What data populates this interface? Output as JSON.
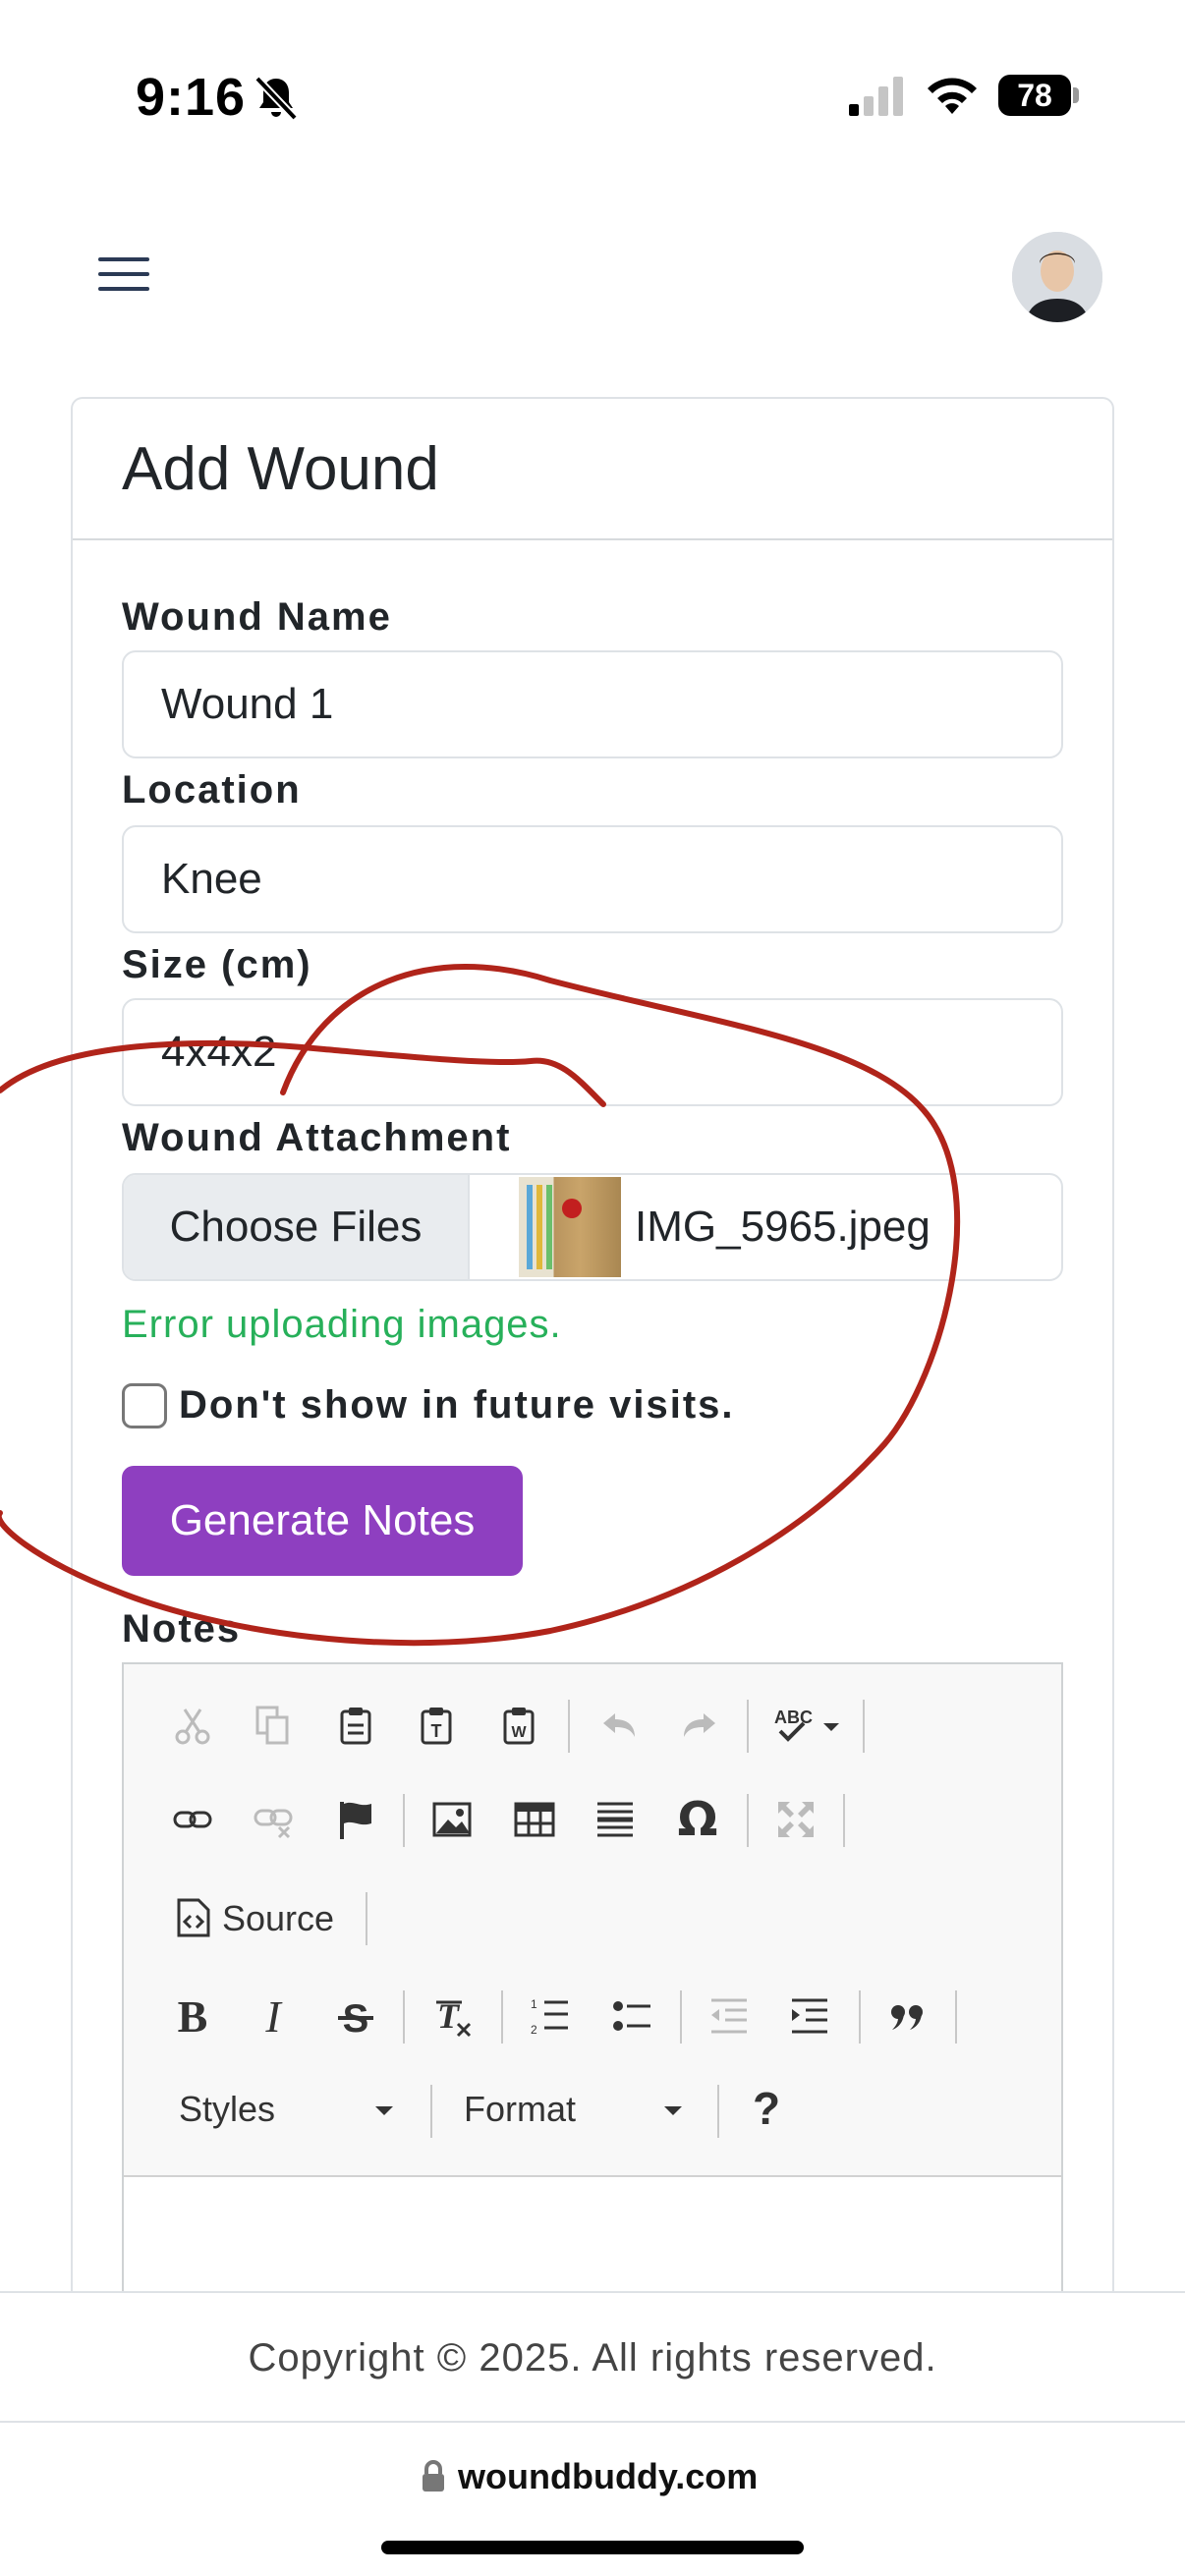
{
  "status_bar": {
    "time": "9:16",
    "battery": "78"
  },
  "page": {
    "title": "Add Wound"
  },
  "form": {
    "wound_name_label": "Wound Name",
    "wound_name_value": "Wound 1",
    "location_label": "Location",
    "location_value": "Knee",
    "size_label": "Size (cm)",
    "size_value": "4x4x2",
    "attachment_label": "Wound Attachment",
    "choose_files_label": "Choose Files",
    "file_name": "IMG_5965.jpeg",
    "error_message": "Error uploading images.",
    "checkbox_label": "Don't show in future visits.",
    "checkbox_checked": false,
    "generate_button": "Generate Notes",
    "notes_label": "Notes"
  },
  "editor": {
    "source_label": "Source",
    "styles_label": "Styles",
    "format_label": "Format",
    "help_label": "?",
    "bold_label": "B",
    "italic_label": "I",
    "omega_label": "Ω"
  },
  "footer": {
    "copyright": "Copyright © 2025. All rights reserved."
  },
  "browser": {
    "url": "woundbuddy.com"
  },
  "colors": {
    "accent_button": "#8e3fc0",
    "error_text": "#27b05a",
    "annotation_stroke": "#b0241a"
  }
}
